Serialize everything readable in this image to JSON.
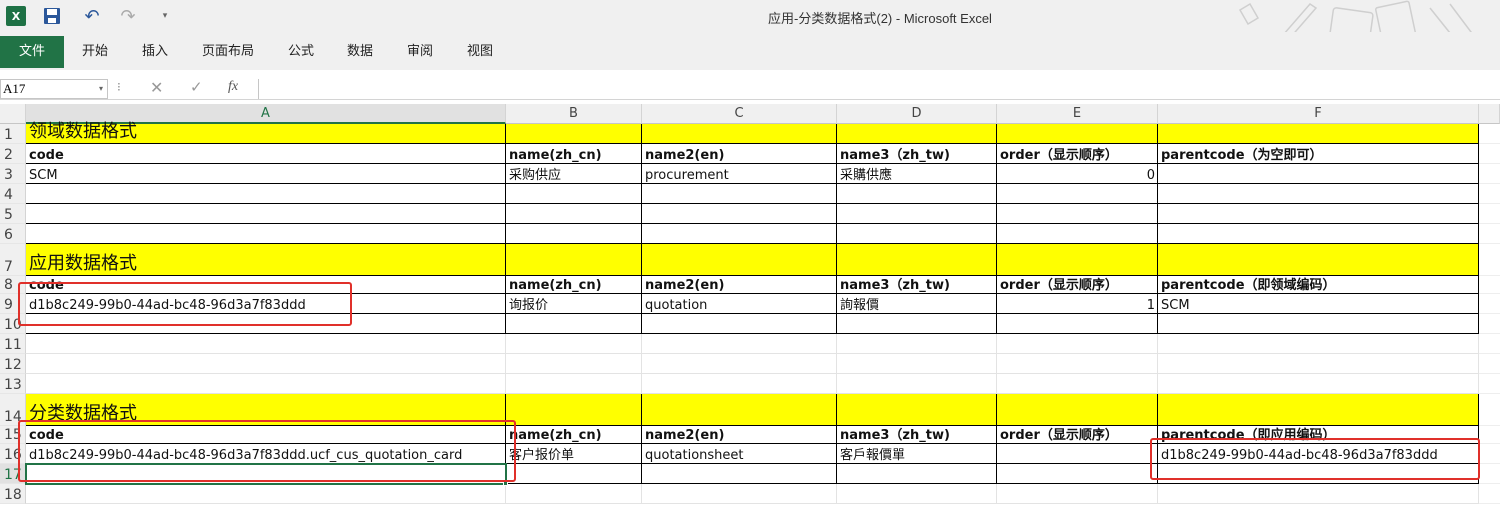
{
  "window": {
    "title": "应用-分类数据格式(2) - Microsoft Excel",
    "app_badge": "X"
  },
  "ribbon": {
    "tabs": [
      "文件",
      "开始",
      "插入",
      "页面布局",
      "公式",
      "数据",
      "审阅",
      "视图"
    ]
  },
  "formula_bar": {
    "name_box": "A17",
    "fx": "fx",
    "content": ""
  },
  "columns": [
    "A",
    "B",
    "C",
    "D",
    "E",
    "F"
  ],
  "selected_cell": "A17",
  "sheet": {
    "rows": [
      {
        "n": "1",
        "cells": [
          "领域数据格式",
          "",
          "",
          "",
          "",
          ""
        ],
        "style": "section"
      },
      {
        "n": "2",
        "cells": [
          "code",
          "name(zh_cn)",
          "name2(en)",
          "name3（zh_tw)",
          "order（显示顺序）",
          "parentcode（为空即可）"
        ],
        "style": "header"
      },
      {
        "n": "3",
        "cells": [
          "SCM",
          "采购供应",
          "procurement",
          "采購供應",
          "0",
          ""
        ],
        "style": "data"
      },
      {
        "n": "4",
        "cells": [
          "",
          "",
          "",
          "",
          "",
          ""
        ],
        "style": "data"
      },
      {
        "n": "5",
        "cells": [
          "",
          "",
          "",
          "",
          "",
          ""
        ],
        "style": "data"
      },
      {
        "n": "6",
        "cells": [
          "",
          "",
          "",
          "",
          "",
          ""
        ],
        "style": "data"
      },
      {
        "n": "7",
        "cells": [
          "应用数据格式",
          "",
          "",
          "",
          "",
          ""
        ],
        "style": "section"
      },
      {
        "n": "8",
        "cells": [
          "code",
          "name(zh_cn)",
          "name2(en)",
          "name3（zh_tw)",
          "order（显示顺序）",
          "parentcode（即领域编码）"
        ],
        "style": "header"
      },
      {
        "n": "9",
        "cells": [
          "d1b8c249-99b0-44ad-bc48-96d3a7f83ddd",
          "询报价",
          "quotation",
          "詢報價",
          "1",
          "SCM"
        ],
        "style": "data"
      },
      {
        "n": "10",
        "cells": [
          "",
          "",
          "",
          "",
          "",
          ""
        ],
        "style": "data"
      },
      {
        "n": "11",
        "cells": [
          "",
          "",
          "",
          "",
          "",
          ""
        ],
        "style": "empty"
      },
      {
        "n": "12",
        "cells": [
          "",
          "",
          "",
          "",
          "",
          ""
        ],
        "style": "empty"
      },
      {
        "n": "13",
        "cells": [
          "",
          "",
          "",
          "",
          "",
          ""
        ],
        "style": "empty"
      },
      {
        "n": "14",
        "cells": [
          "分类数据格式",
          "",
          "",
          "",
          "",
          ""
        ],
        "style": "section"
      },
      {
        "n": "15",
        "cells": [
          "code",
          "name(zh_cn)",
          "name2(en)",
          "name3（zh_tw)",
          "order（显示顺序）",
          "parentcode（即应用编码）"
        ],
        "style": "header"
      },
      {
        "n": "16",
        "cells": [
          "d1b8c249-99b0-44ad-bc48-96d3a7f83ddd.ucf_cus_quotation_card",
          "客户报价单",
          "quotationsheet",
          "客戶報價單",
          "",
          "d1b8c249-99b0-44ad-bc48-96d3a7f83ddd"
        ],
        "style": "data"
      },
      {
        "n": "17",
        "cells": [
          "",
          "",
          "",
          "",
          "",
          ""
        ],
        "style": "data"
      },
      {
        "n": "18",
        "cells": [
          "",
          "",
          "",
          "",
          "",
          ""
        ],
        "style": "empty"
      }
    ]
  },
  "colors": {
    "excel_green": "#217346",
    "section_fill": "#ffff00",
    "annotation_red": "#e0302a"
  }
}
